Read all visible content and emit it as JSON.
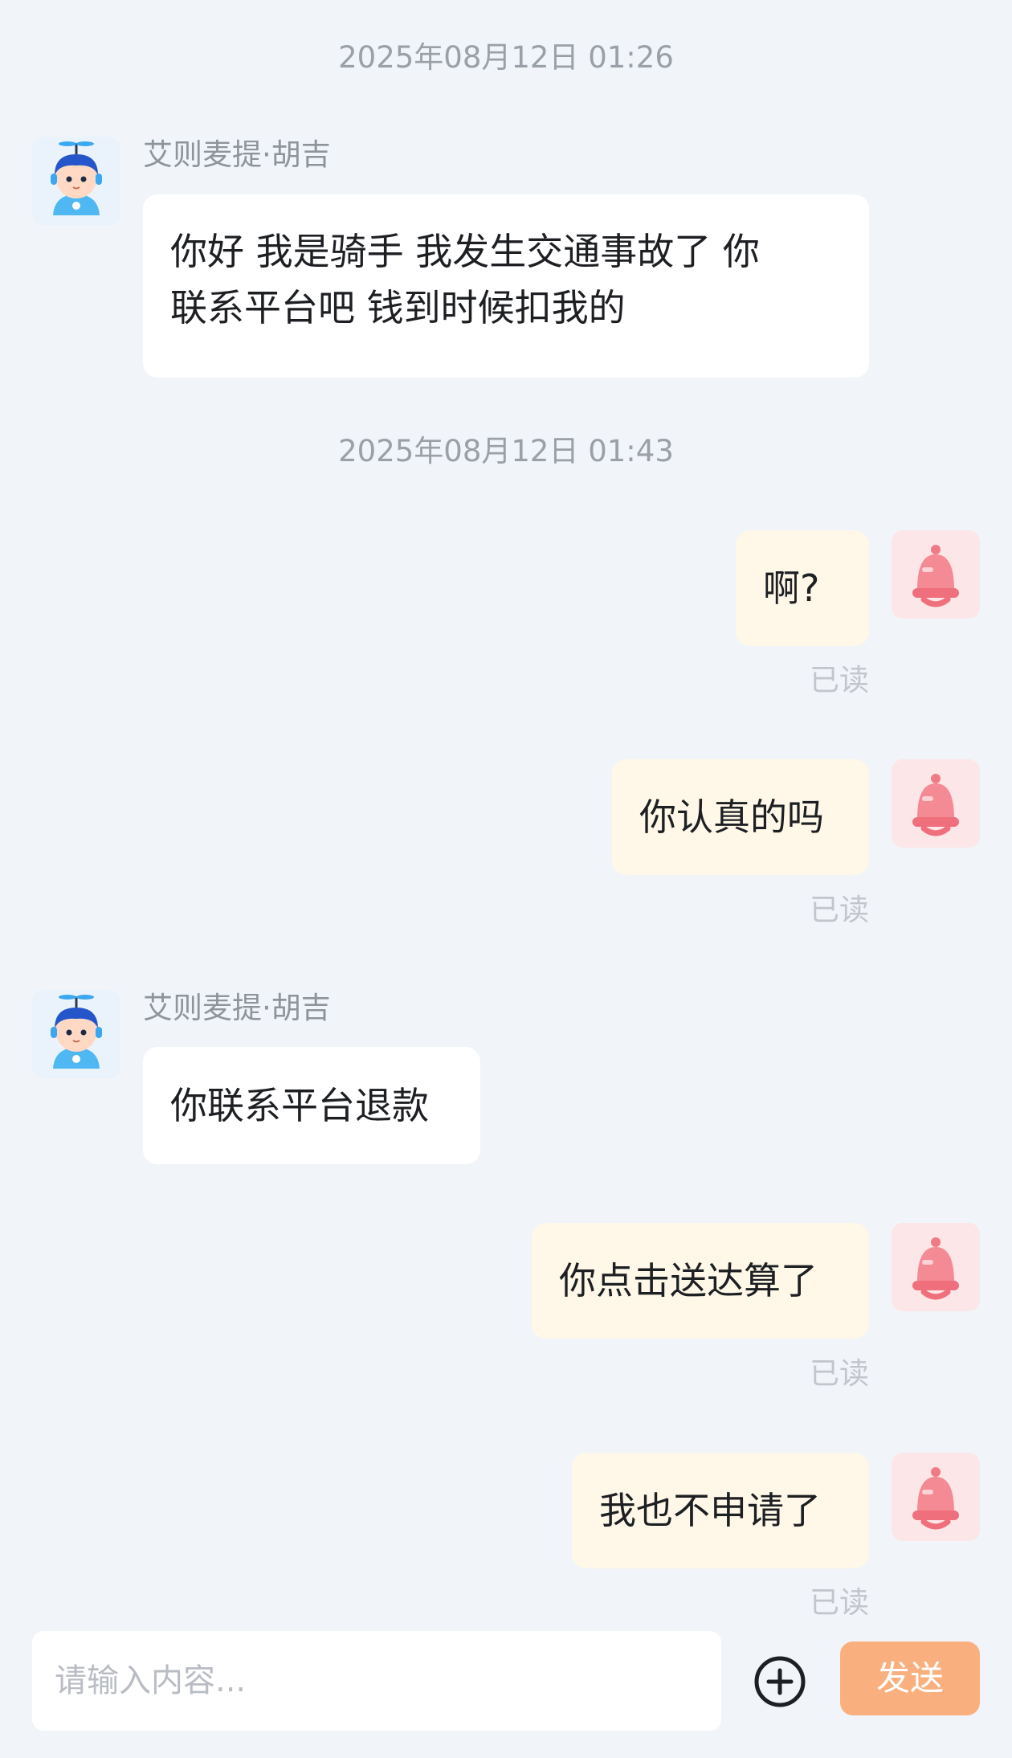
{
  "messages": {
    "ts1": "2025年08月12日 01:26",
    "ts2": "2025年08月12日 01:43",
    "m1": {
      "sender": "艾则麦提·胡吉",
      "line1": "你好 我是骑手 我发生交通事故了 你",
      "line2": "联系平台吧 钱到时候扣我的"
    },
    "m2": {
      "text": "啊?",
      "status": "已读"
    },
    "m3": {
      "text": "你认真的吗",
      "status": "已读"
    },
    "m4": {
      "sender": "艾则麦提·胡吉",
      "text": "你联系平台退款"
    },
    "m5": {
      "text": "你点击送达算了",
      "status": "已读"
    },
    "m6": {
      "text": "我也不申请了",
      "status": "已读"
    }
  },
  "input": {
    "placeholder": "请输入内容...",
    "send_label": "发送"
  },
  "icons": {
    "rider_avatar": "rider-boy-avatar-icon",
    "user_avatar": "pink-bell-avatar-icon",
    "add": "plus-circle-icon"
  },
  "colors": {
    "background": "#f1f4f8",
    "incoming_bubble": "#ffffff",
    "outgoing_bubble": "#fff8e8",
    "send_button": "#f9b07e"
  }
}
